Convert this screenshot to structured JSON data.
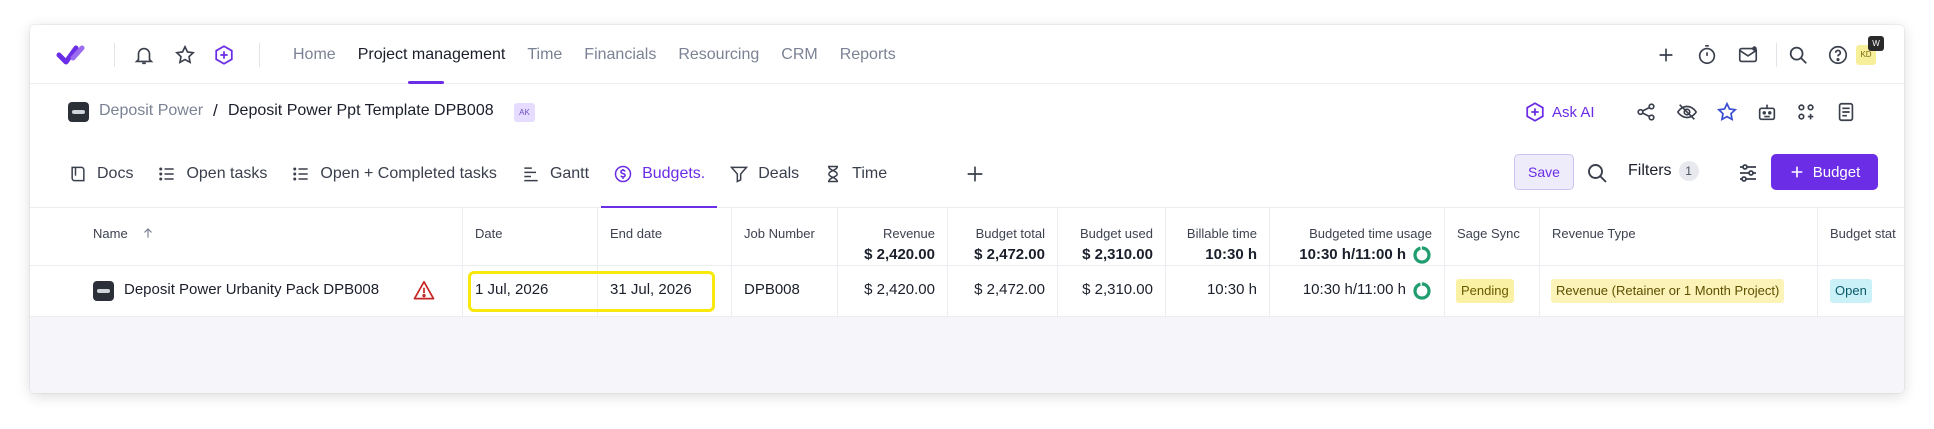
{
  "nav": {
    "links": [
      "Home",
      "Project management",
      "Time",
      "Financials",
      "Resourcing",
      "CRM",
      "Reports"
    ],
    "active_index": 1,
    "avatar_initials": "KD",
    "avatar_badge": "W"
  },
  "breadcrumb": {
    "project": "Deposit Power",
    "separator": "/",
    "title": "Deposit Power Ppt Template DPB008",
    "badge": "AK",
    "ask_ai": "Ask AI"
  },
  "tabs": [
    {
      "label": "Docs",
      "icon": "docs-icon"
    },
    {
      "label": "Open tasks",
      "icon": "list-icon"
    },
    {
      "label": "Open + Completed tasks",
      "icon": "list-icon"
    },
    {
      "label": "Gantt",
      "icon": "gantt-icon"
    },
    {
      "label": "Budgets.",
      "icon": "dollar-icon"
    },
    {
      "label": "Deals",
      "icon": "funnel-icon"
    },
    {
      "label": "Time",
      "icon": "hourglass-icon"
    }
  ],
  "toolbar": {
    "save_label": "Save",
    "filters_label": "Filters",
    "filters_count": "1",
    "budget_button_label": "Budget"
  },
  "table": {
    "headers": {
      "name": "Name",
      "date": "Date",
      "end_date": "End date",
      "job_number": "Job Number",
      "revenue": "Revenue",
      "budget_total": "Budget total",
      "budget_used": "Budget used",
      "billable_time": "Billable time",
      "budgeted_time_usage": "Budgeted time usage",
      "sage_sync": "Sage Sync",
      "revenue_type": "Revenue Type",
      "budget_status": "Budget stat"
    },
    "totals": {
      "revenue": "$ 2,420.00",
      "budget_total": "$ 2,472.00",
      "budget_used": "$ 2,310.00",
      "billable_time": "10:30 h",
      "budgeted_time_usage": "10:30 h/11:00 h",
      "time_usage_fraction": 0.955
    },
    "rows": [
      {
        "name": "Deposit Power Urbanity Pack DPB008",
        "date": "1 Jul, 2026",
        "end_date": "31 Jul, 2026",
        "job_number": "DPB008",
        "revenue": "$ 2,420.00",
        "budget_total": "$ 2,472.00",
        "budget_used": "$ 2,310.00",
        "billable_time": "10:30 h",
        "budgeted_time_usage": "10:30 h/11:00 h",
        "time_usage_fraction": 0.955,
        "sage_sync": "Pending",
        "revenue_type": "Revenue (Retainer or 1 Month Project)",
        "budget_status": "Open"
      }
    ]
  },
  "colors": {
    "accent": "#6b2de5",
    "donut": "#1f9d6e",
    "pending_bg": "#faf1a4",
    "revenue_type_bg": "#fbf3b8",
    "open_bg": "#c9f1f7",
    "warning": "#c62828",
    "highlight": "#f9e80c"
  }
}
